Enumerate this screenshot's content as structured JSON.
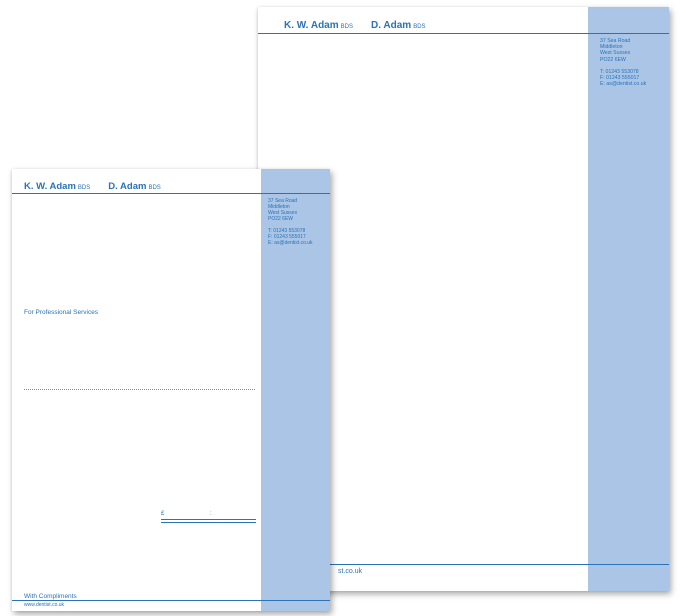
{
  "letterhead": {
    "name1": "K. W. Adam",
    "name2": "D. Adam",
    "qualification": "BDS",
    "address": [
      "37 Sea Road",
      "Middleton",
      "West Sussex",
      "PO22 6EW"
    ],
    "contact": [
      "T: 01243 553078",
      "F: 01243 555017",
      "E: as@dentist.co.uk"
    ],
    "footer_web_fragment": "st.co.uk"
  },
  "compliment_slip": {
    "name1": "K. W. Adam",
    "name2": "D. Adam",
    "qualification": "BDS",
    "address": [
      "37 Sea Road",
      "Middleton",
      "West Sussex",
      "PO22 6EW"
    ],
    "contact": [
      "T: 01243 553078",
      "F: 01243 555017",
      "E: as@dentist.co.uk"
    ],
    "services_label": "For Professional Services",
    "pound_symbol": "£",
    "colon_symbol": ":",
    "footer_label": "With Compliments",
    "footer_web": "www.dentist.co.uk"
  },
  "colors": {
    "brand_blue": "#2a73b8",
    "sidebar_blue": "#abc5e6"
  }
}
